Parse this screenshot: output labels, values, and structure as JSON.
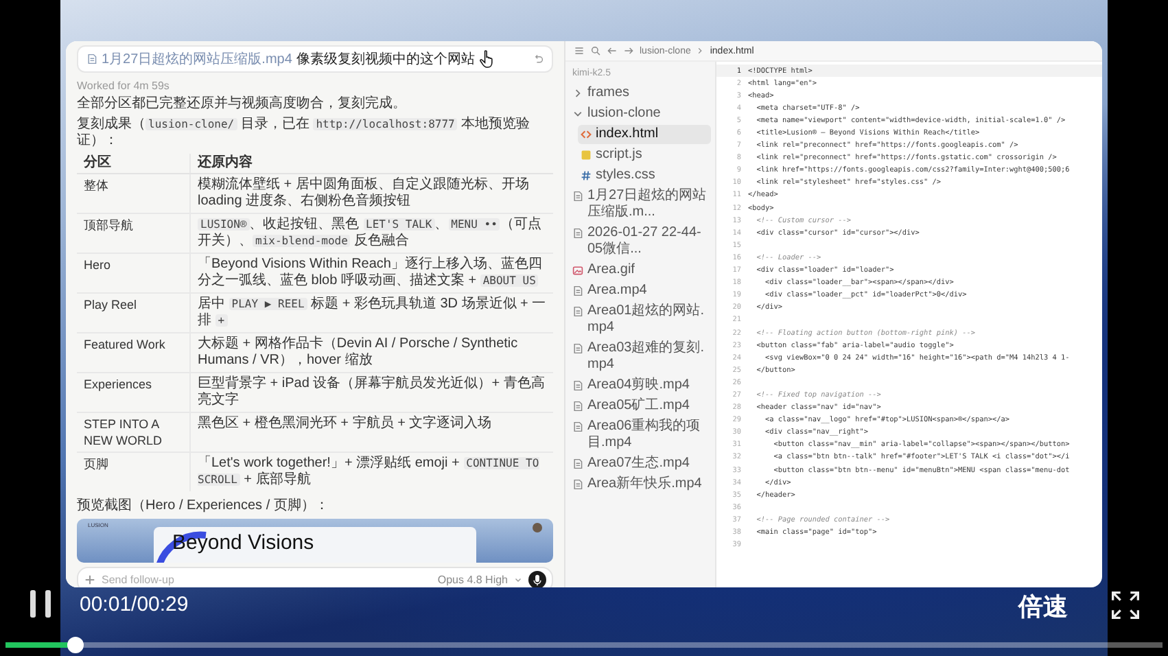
{
  "chat": {
    "prompt": {
      "attachment": "1月27日超炫的网站压缩版.mp4",
      "text": "像素级复刻视频中的这个网站"
    },
    "worked": "Worked for 4m 59s",
    "summary": "全部分区都已完整还原并与视频高度吻合，复刻完成。",
    "result": [
      {
        "text": "复刻成果（",
        "code": false
      },
      {
        "text": "lusion-clone/",
        "code": true
      },
      {
        "text": " 目录，已在 ",
        "code": false
      },
      {
        "text": "http://localhost:8777",
        "code": true
      },
      {
        "text": " 本地预览验证）：",
        "code": false
      }
    ],
    "table": {
      "columns": [
        "分区",
        "还原内容"
      ],
      "rows": [
        {
          "section": "整体",
          "content": [
            {
              "text": "模糊流体壁纸 + 居中圆角面板、自定义跟随光标、开场 loading 进度条、右侧粉色音频按钮",
              "code": false
            }
          ]
        },
        {
          "section": "顶部导航",
          "content": [
            {
              "text": "LUSION®",
              "code": true
            },
            {
              "text": "、收起按钮、黑色 ",
              "code": false
            },
            {
              "text": "LET'S TALK",
              "code": true
            },
            {
              "text": "、",
              "code": false
            },
            {
              "text": "MENU ••",
              "code": true
            },
            {
              "text": "（可点开关）、",
              "code": false
            },
            {
              "text": "mix-blend-mode",
              "code": true
            },
            {
              "text": " 反色融合",
              "code": false
            }
          ]
        },
        {
          "section": "Hero",
          "content": [
            {
              "text": "「Beyond Visions Within Reach」逐行上移入场、蓝色四分之一弧线、蓝色 blob 呼吸动画、描述文案 + ",
              "code": false
            },
            {
              "text": "ABOUT US",
              "code": true
            }
          ]
        },
        {
          "section": "Play Reel",
          "content": [
            {
              "text": "居中 ",
              "code": false
            },
            {
              "text": "PLAY ▶ REEL",
              "code": true
            },
            {
              "text": " 标题 + 彩色玩具轨道 3D 场景近似 + 一排 ",
              "code": false
            },
            {
              "text": "+",
              "code": true
            }
          ]
        },
        {
          "section": "Featured Work",
          "content": [
            {
              "text": "大标题 + 网格作品卡（Devin AI / Porsche / Synthetic Humans / VR），hover 缩放",
              "code": false
            }
          ]
        },
        {
          "section": "Experiences",
          "content": [
            {
              "text": "巨型背景字 + iPad 设备（屏幕宇航员发光近似）+ 青色高亮文字",
              "code": false
            }
          ]
        },
        {
          "section": "STEP INTO A NEW WORLD",
          "content": [
            {
              "text": "黑色区 + 橙色黑洞光环 + 宇航员 + 文字逐词入场",
              "code": false
            }
          ]
        },
        {
          "section": "页脚",
          "content": [
            {
              "text": "「Let's work together!」+ 漂浮贴纸 emoji + ",
              "code": false
            },
            {
              "text": "CONTINUE TO SCROLL",
              "code": true
            },
            {
              "text": " + 底部导航",
              "code": false
            }
          ]
        }
      ]
    },
    "preview": {
      "label": "预览截图（Hero / Experiences / 页脚）：",
      "logo": "LUSION",
      "headline": "Beyond Visions"
    },
    "composer": {
      "placeholder": "Send follow-up",
      "model": "Opus 4.8 High"
    }
  },
  "explorer": {
    "root": "kimi-k2.5",
    "items": [
      {
        "name": "frames",
        "kind": "folder",
        "expanded": false,
        "selected": false
      },
      {
        "name": "lusion-clone",
        "kind": "folder",
        "expanded": true,
        "selected": false,
        "children": [
          {
            "name": "index.html",
            "kind": "html",
            "selected": true
          },
          {
            "name": "script.js",
            "kind": "js",
            "selected": false
          },
          {
            "name": "styles.css",
            "kind": "css",
            "selected": false
          }
        ]
      },
      {
        "name": "1月27日超炫的网站压缩版.m...",
        "kind": "video",
        "selected": false
      },
      {
        "name": "2026-01-27 22-44-05微信...",
        "kind": "video",
        "selected": false
      },
      {
        "name": "Area.gif",
        "kind": "gif",
        "selected": false
      },
      {
        "name": "Area.mp4",
        "kind": "video",
        "selected": false
      },
      {
        "name": "Area01超炫的网站.mp4",
        "kind": "video",
        "selected": false
      },
      {
        "name": "Area03超难的复刻.mp4",
        "kind": "video",
        "selected": false
      },
      {
        "name": "Area04剪映.mp4",
        "kind": "video",
        "selected": false
      },
      {
        "name": "Area05矿工.mp4",
        "kind": "video",
        "selected": false
      },
      {
        "name": "Area06重构我的项目.mp4",
        "kind": "video",
        "selected": false
      },
      {
        "name": "Area07生态.mp4",
        "kind": "video",
        "selected": false
      },
      {
        "name": "Area新年快乐.mp4",
        "kind": "video",
        "selected": false
      }
    ]
  },
  "editor": {
    "breadcrumb": [
      "lusion-clone",
      "index.html"
    ],
    "lines": [
      {
        "number": "1",
        "text": "<!DOCTYPE html>",
        "kind": "markup"
      },
      {
        "number": "2",
        "text": "<html lang=\"en\">",
        "kind": "markup"
      },
      {
        "number": "3",
        "text": "<head>",
        "kind": "markup"
      },
      {
        "number": "4",
        "text": "  <meta charset=\"UTF-8\" />",
        "kind": "markup"
      },
      {
        "number": "5",
        "text": "  <meta name=\"viewport\" content=\"width=device-width, initial-scale=1.0\" />",
        "kind": "markup"
      },
      {
        "number": "6",
        "text": "  <title>Lusion® — Beyond Visions Within Reach</title>",
        "kind": "markup"
      },
      {
        "number": "7",
        "text": "  <link rel=\"preconnect\" href=\"https://fonts.googleapis.com\" />",
        "kind": "markup"
      },
      {
        "number": "8",
        "text": "  <link rel=\"preconnect\" href=\"https://fonts.gstatic.com\" crossorigin />",
        "kind": "markup"
      },
      {
        "number": "9",
        "text": "  <link href=\"https://fonts.googleapis.com/css2?family=Inter:wght@400;500;6",
        "kind": "markup"
      },
      {
        "number": "10",
        "text": "  <link rel=\"stylesheet\" href=\"styles.css\" />",
        "kind": "markup"
      },
      {
        "number": "11",
        "text": "</head>",
        "kind": "markup"
      },
      {
        "number": "12",
        "text": "<body>",
        "kind": "markup"
      },
      {
        "number": "13",
        "text": "  <!-- Custom cursor -->",
        "kind": "comment"
      },
      {
        "number": "14",
        "text": "  <div class=\"cursor\" id=\"cursor\"></div>",
        "kind": "markup"
      },
      {
        "number": "15"
      },
      {
        "number": "16",
        "text": "  <!-- Loader -->",
        "kind": "comment"
      },
      {
        "number": "17",
        "text": "  <div class=\"loader\" id=\"loader\">",
        "kind": "markup"
      },
      {
        "number": "18",
        "text": "    <div class=\"loader__bar\"><span></span></div>",
        "kind": "markup"
      },
      {
        "number": "19",
        "text": "    <div class=\"loader__pct\" id=\"loaderPct\">0</div>",
        "kind": "markup"
      },
      {
        "number": "20",
        "text": "  </div>",
        "kind": "markup"
      },
      {
        "number": "21"
      },
      {
        "number": "22",
        "text": "  <!-- Floating action button (bottom-right pink) -->",
        "kind": "comment"
      },
      {
        "number": "23",
        "text": "  <button class=\"fab\" aria-label=\"audio toggle\">",
        "kind": "markup"
      },
      {
        "number": "24",
        "text": "    <svg viewBox=\"0 0 24 24\" width=\"16\" height=\"16\"><path d=\"M4 14h2l3 4 1-",
        "kind": "markup"
      },
      {
        "number": "25",
        "text": "  </button>",
        "kind": "markup"
      },
      {
        "number": "26"
      },
      {
        "number": "27",
        "text": "  <!-- Fixed top navigation -->",
        "kind": "comment"
      },
      {
        "number": "28",
        "text": "  <header class=\"nav\" id=\"nav\">",
        "kind": "markup"
      },
      {
        "number": "29",
        "text": "    <a class=\"nav__logo\" href=\"#top\">LUSION<span>®</span></a>",
        "kind": "markup"
      },
      {
        "number": "30",
        "text": "    <div class=\"nav__right\">",
        "kind": "markup"
      },
      {
        "number": "31",
        "text": "      <button class=\"nav__min\" aria-label=\"collapse\"><span></span></button>",
        "kind": "markup"
      },
      {
        "number": "32",
        "text": "      <a class=\"btn btn--talk\" href=\"#footer\">LET'S TALK <i class=\"dot\"></i",
        "kind": "markup"
      },
      {
        "number": "33",
        "text": "      <button class=\"btn btn--menu\" id=\"menuBtn\">MENU <span class=\"menu-dot",
        "kind": "markup"
      },
      {
        "number": "34",
        "text": "    </div>",
        "kind": "markup"
      },
      {
        "number": "35",
        "text": "  </header>",
        "kind": "markup"
      },
      {
        "number": "36"
      },
      {
        "number": "37",
        "text": "  <!-- Page rounded container -->",
        "kind": "comment"
      },
      {
        "number": "38",
        "text": "  <main class=\"page\" id=\"top\">",
        "kind": "markup"
      },
      {
        "number": "39"
      }
    ]
  },
  "player": {
    "playing": true,
    "time": "00:01/00:29",
    "speed": "倍速",
    "level": 0.065
  }
}
